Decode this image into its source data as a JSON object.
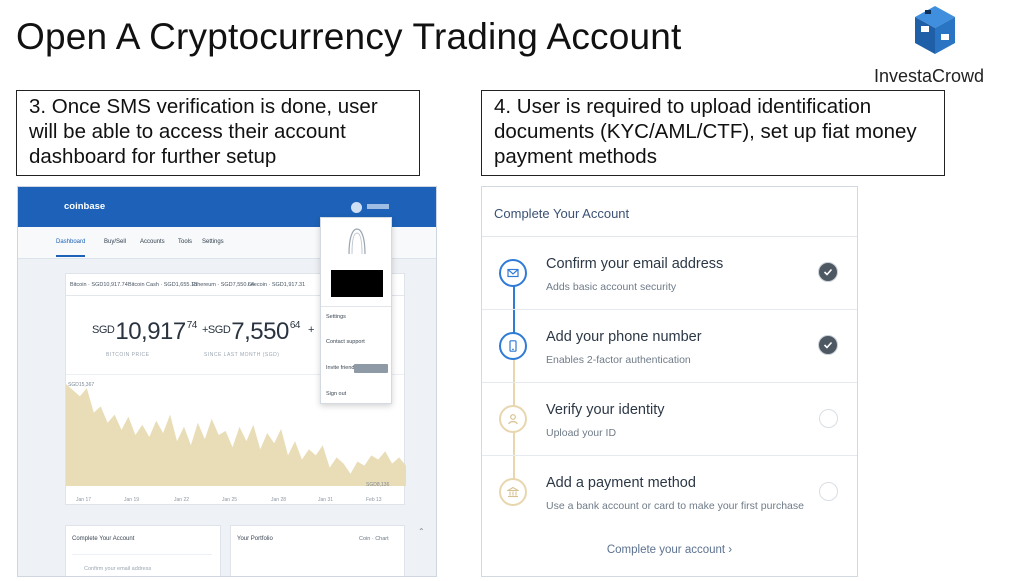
{
  "title": "Open A Cryptocurrency Trading Account",
  "logo": {
    "text": "InvestaCrowd",
    "icon": "investacrowd-cube-logo"
  },
  "callouts": {
    "left": "3. Once SMS verification is done, user will be able to access their account dashboard for further setup",
    "right": "4. User is required to upload identification documents (KYC/AML/CTF), set up fiat money payment methods"
  },
  "dashboard": {
    "brand": "coinbase",
    "nav": [
      "Dashboard",
      "Buy/Sell",
      "Accounts",
      "Tools",
      "Settings"
    ],
    "ticker": [
      "Bitcoin · SGD10,917.74",
      "Bitcoin Cash · SGD1,655.15",
      "Ethereum · SGD7,550.64",
      "Litecoin · SGD1,917.31"
    ],
    "prices": [
      {
        "currency": "SGD",
        "main": "10,917",
        "cents": "74",
        "label": "BITCOIN PRICE"
      },
      {
        "currency": "+SGD",
        "main": "7,550",
        "cents": "64",
        "label": "SINCE LAST MONTH (SGD)"
      },
      {
        "currency": "+",
        "main": "",
        "cents": "",
        "label": ""
      }
    ],
    "dropdown": {
      "items": [
        "Settings",
        "Contact support",
        "Invite friends",
        "Sign out"
      ]
    },
    "axis_labels": [
      "Jan 17",
      "Jan 19",
      "Jan 22",
      "Jan 25",
      "Jan 28",
      "Jan 31",
      "Feb 13"
    ],
    "side_labels": {
      "high": "SGD15,367",
      "low": "SGD8,136"
    },
    "cards": {
      "left_title": "Complete Your Account",
      "left_row": "Confirm your email address",
      "right_title": "Your Portfolio",
      "right_sub": "Coin · Chart"
    },
    "chart_data": {
      "type": "area",
      "values": [
        100,
        94,
        88,
        96,
        72,
        78,
        62,
        70,
        55,
        68,
        50,
        60,
        48,
        64,
        52,
        70,
        44,
        58,
        40,
        62,
        46,
        66,
        50,
        54,
        38,
        58,
        44,
        60,
        36,
        52,
        42,
        56,
        30,
        44,
        26,
        36,
        30,
        40,
        18,
        28,
        22,
        12,
        24,
        20,
        30,
        26,
        34,
        22,
        28,
        20
      ],
      "color": "#e9ddb8"
    }
  },
  "complete_account": {
    "title": "Complete Your Account",
    "steps": [
      {
        "title": "Confirm your email address",
        "subtitle": "Adds basic account security",
        "icon": "email-icon",
        "done": true
      },
      {
        "title": "Add your phone number",
        "subtitle": "Enables 2-factor authentication",
        "icon": "phone-icon",
        "done": true
      },
      {
        "title": "Verify your identity",
        "subtitle": "Upload your ID",
        "icon": "person-icon",
        "done": false
      },
      {
        "title": "Add a payment method",
        "subtitle": "Use a bank account or card to make your first purchase",
        "icon": "bank-icon",
        "done": false
      }
    ],
    "footer_link": "Complete your account ›",
    "colors": {
      "accent": "#2f7bd6",
      "pending": "#e8d6ae",
      "check": "#4d5863"
    }
  }
}
